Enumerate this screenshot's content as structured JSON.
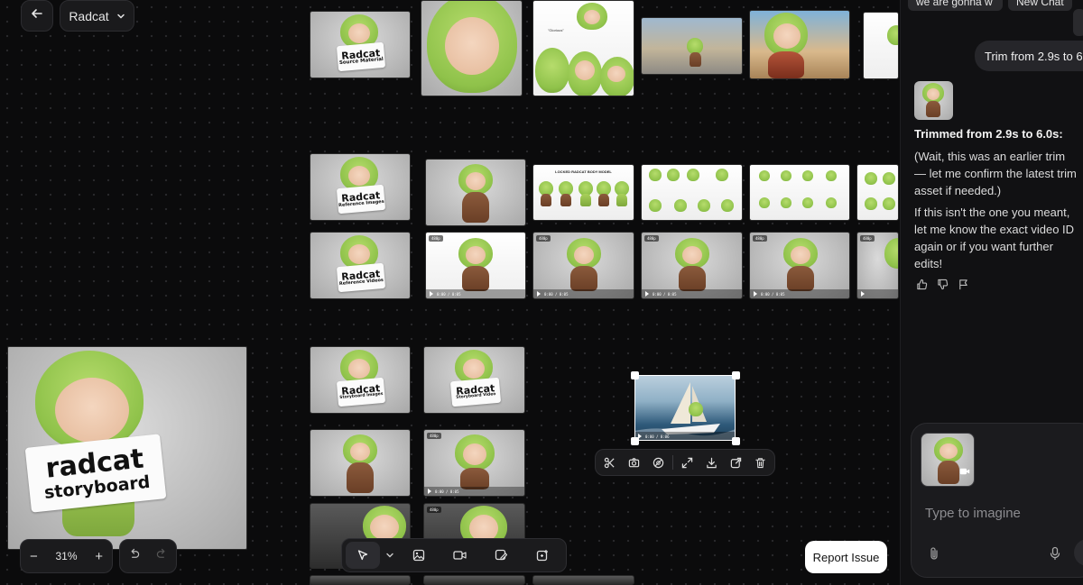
{
  "header": {
    "back_icon": "arrow-left-icon",
    "project_name": "Radcat",
    "project_chevron": "chevron-down-icon"
  },
  "canvas": {
    "source_sign": {
      "big": "Radcat",
      "small": "Source Material"
    },
    "ref_images_sign": {
      "big": "Radcat",
      "small": "Reference Images"
    },
    "ref_videos_sign": {
      "big": "Radcat",
      "small": "Reference Videos"
    },
    "story_images_sign": {
      "big": "Radcat",
      "small": "Storyboard Images"
    },
    "story_video_sign": {
      "big": "Radcat",
      "small": "Storyboard Video"
    },
    "storyboard_cover": {
      "line1": "radcat",
      "line2": "storyboard"
    },
    "model_sheet_title": "LOCKED RADCAT BODY MODEL",
    "collage_caption": "\"Glorious\"",
    "video_badge": "480p",
    "video_time": "0:00 / 0:05",
    "selected_video_time": "0:00 / 0:06"
  },
  "selection_toolbar": {
    "icons": [
      "scissors-icon",
      "camera-icon",
      "remove-bg-icon",
      "expand-icon",
      "download-icon",
      "share-icon",
      "trash-icon"
    ]
  },
  "zoom": {
    "minus": "−",
    "level": "31%",
    "plus": "+",
    "undo_icon": "undo-icon",
    "redo_icon": "redo-icon"
  },
  "bottom_toolbar": {
    "icons": [
      "pointer-icon",
      "chevron-down-icon",
      "image-icon",
      "video-icon",
      "edit-image-icon",
      "magic-add-icon"
    ]
  },
  "report_issue": "Report Issue",
  "chat": {
    "chips": [
      "we are gonna w",
      "New Chat"
    ],
    "user_message": "Trim from 2.9s to 6",
    "assistant_title": "Trimmed from 2.9s to 6.0s:",
    "assistant_p1": "(Wait, this was an earlier trim — let me confirm the latest trim asset if needed.)",
    "assistant_p2": "If this isn't the one you meant, let me know the exact video ID again or if you want further edits!",
    "feedback_icons": [
      "thumbs-up-icon",
      "thumbs-down-icon",
      "flag-icon"
    ],
    "composer_placeholder": "Type to imagine",
    "attach_icon": "paperclip-icon",
    "mic_icon": "microphone-icon"
  },
  "colors": {
    "canvas_bg": "#0b0b0c",
    "panel_bg": "#111113",
    "frog_green": "#8fc24a",
    "frog_brown": "#6a3f26"
  }
}
